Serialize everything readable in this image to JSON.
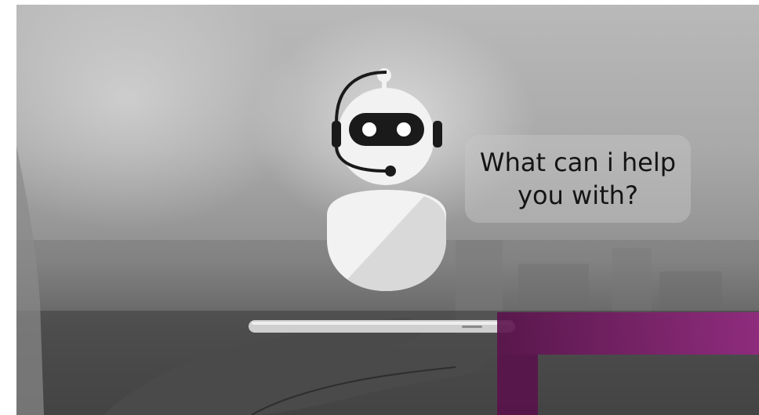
{
  "bubble": {
    "message": "What can i help you with?"
  },
  "colors": {
    "accent": "#8c2878",
    "bubble_bg": "#c8c8c8",
    "robot_white": "#f2f2f2",
    "robot_visor": "#1a1a1a"
  },
  "icons": {
    "assistant": "robot-icon",
    "device": "smartphone-icon"
  }
}
